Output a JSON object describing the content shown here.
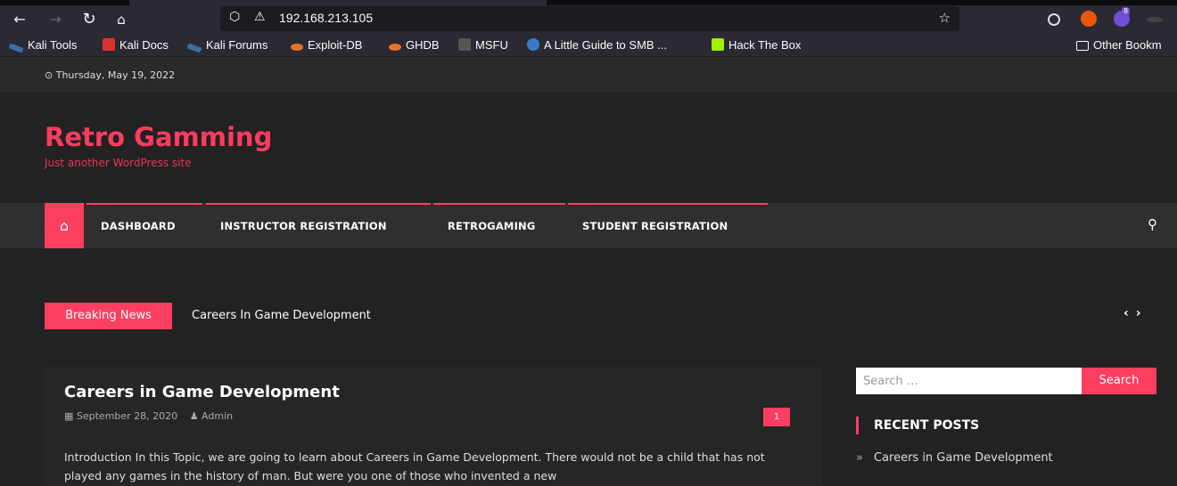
{
  "browser": {
    "url": "192.168.213.105",
    "bookmarks": [
      "Kali Tools",
      "Kali Docs",
      "Kali Forums",
      "Exploit-DB",
      "GHDB",
      "MSFU",
      "A Little Guide to SMB ...",
      "Hack The Box"
    ],
    "other_bookmarks": "Other Bookm",
    "extension_badge": "8"
  },
  "site": {
    "date": "Thursday, May 19, 2022",
    "title": "Retro Gamming",
    "tagline": "Just another WordPress site",
    "menu": [
      "DASHBOARD",
      "INSTRUCTOR REGISTRATION",
      "RETROGAMING",
      "STUDENT REGISTRATION"
    ],
    "breaking_label": "Breaking News",
    "breaking_text": "Careers In Game Development"
  },
  "article": {
    "title": "Careers in Game Development",
    "date": "September 28, 2020",
    "author": "Admin",
    "comments": "1",
    "excerpt": "Introduction In this Topic, we are going to learn about Careers in Game Development. There would not be a child that has not played any games in the history of man. But were you one of those who invented a new"
  },
  "sidebar": {
    "search_placeholder": "Search …",
    "search_button": "Search",
    "recent_title": "RECENT POSTS",
    "recent_posts": [
      "Careers in Game Development"
    ]
  },
  "colors": {
    "accent": "#fc3e61",
    "background": "#222222"
  }
}
